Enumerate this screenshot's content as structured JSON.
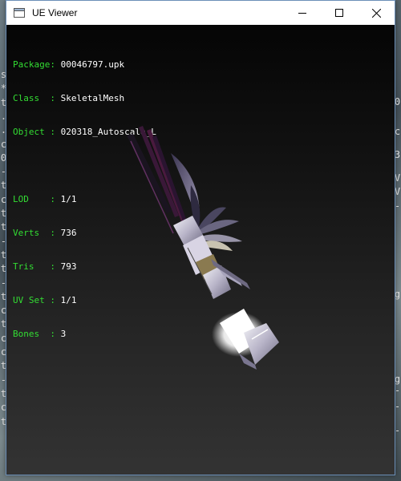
{
  "window": {
    "title": "UE Viewer",
    "controls": {
      "minimize_icon": "minimize-icon",
      "maximize_icon": "maximize-icon",
      "close_icon": "close-icon"
    }
  },
  "info": {
    "package": {
      "key": "Package: ",
      "value": "00046797.upk"
    },
    "class": {
      "key": "Class  : ",
      "value": "SkeletalMesh"
    },
    "object": {
      "key": "Object : ",
      "value": "020318_Autoscale_L"
    },
    "lod": {
      "key": "LOD    : ",
      "value": "1/1"
    },
    "verts": {
      "key": "Verts  : ",
      "value": "736"
    },
    "tris": {
      "key": "Tris   : ",
      "value": "793"
    },
    "uvset": {
      "key": "UV Set : ",
      "value": "1/1"
    },
    "bones": {
      "key": "Bones  : ",
      "value": "3"
    }
  },
  "background_console": {
    "left": [
      "s",
      "*",
      "t",
      ".",
      ".",
      "c",
      "0",
      "-",
      "t",
      "c",
      "t",
      "t",
      "-",
      "t",
      "t",
      "-",
      "t",
      "c",
      "t",
      "c",
      "c",
      "t",
      "-",
      "t",
      "c",
      "t"
    ],
    "right": [
      "0",
      "c",
      "3",
      "V",
      "V",
      "-",
      "g",
      "g",
      "-",
      "-",
      "-"
    ]
  },
  "colors": {
    "label": "#33dd33",
    "value": "#ffffff",
    "viewport_top": "#050505",
    "viewport_bottom": "#333333"
  }
}
